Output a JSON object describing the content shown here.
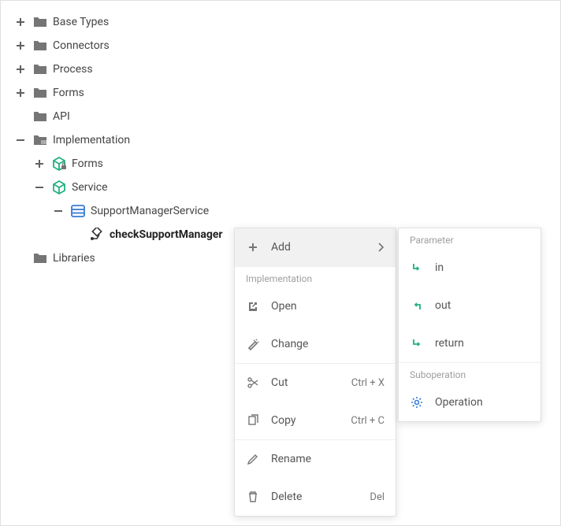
{
  "tree": {
    "base_types": "Base Types",
    "connectors": "Connectors",
    "process": "Process",
    "forms": "Forms",
    "api": "API",
    "implementation": "Implementation",
    "impl_forms": "Forms",
    "service": "Service",
    "support_manager_service": "SupportManagerService",
    "check_support_manager": "checkSupportManager",
    "libraries": "Libraries"
  },
  "context_menu": {
    "add": "Add",
    "section_implementation": "Implementation",
    "open": "Open",
    "change": "Change",
    "cut": "Cut",
    "cut_shortcut": "Ctrl + X",
    "copy": "Copy",
    "copy_shortcut": "Ctrl + C",
    "rename": "Rename",
    "delete": "Delete",
    "delete_shortcut": "Del"
  },
  "submenu": {
    "section_parameter": "Parameter",
    "in": "in",
    "out": "out",
    "return": "return",
    "section_suboperation": "Suboperation",
    "operation": "Operation"
  }
}
